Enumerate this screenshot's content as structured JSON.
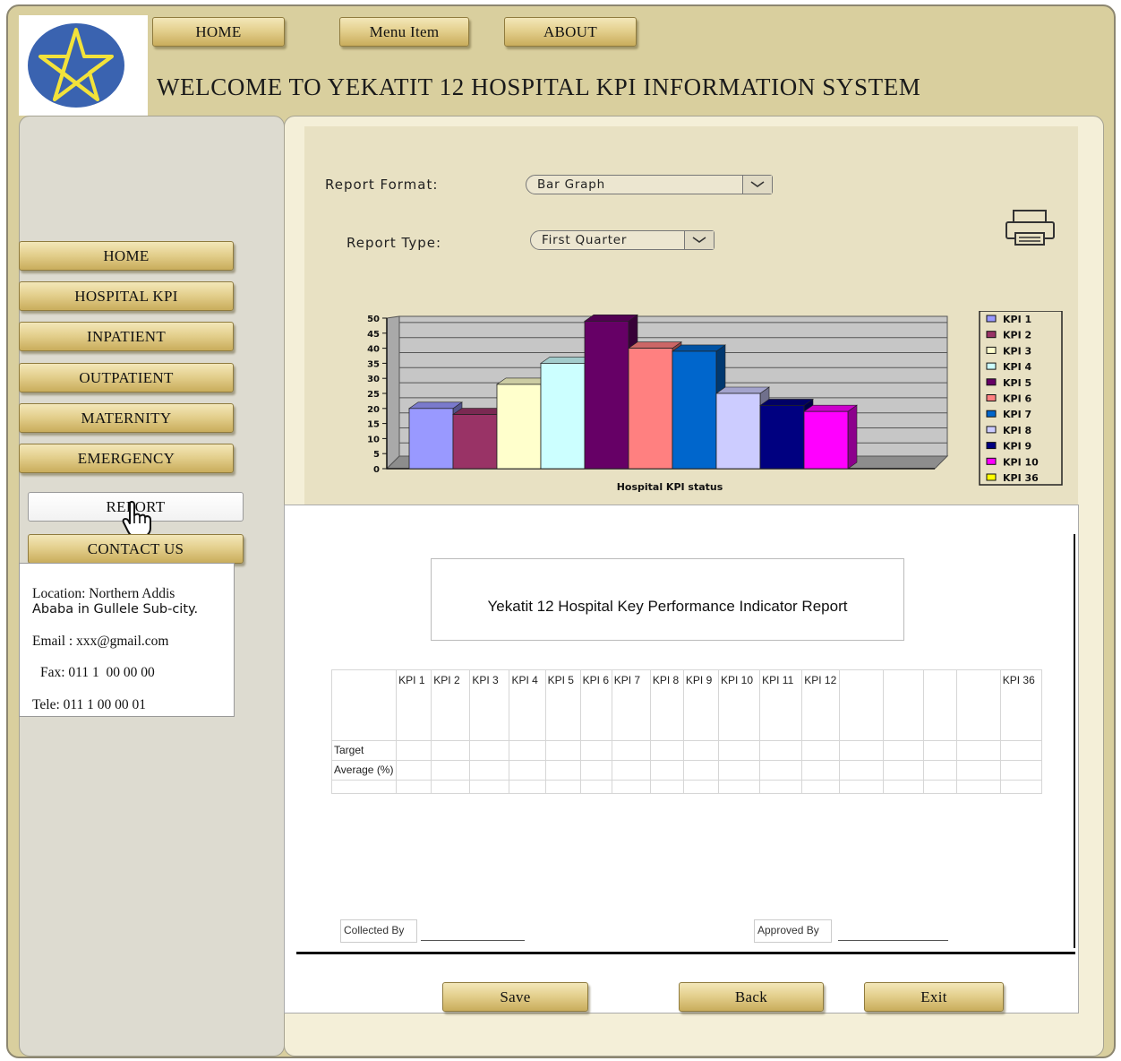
{
  "header": {
    "title": "WELCOME TO YEKATIT 12 HOSPITAL KPI INFORMATION SYSTEM",
    "nav": [
      "HOME",
      "Menu Item",
      "ABOUT"
    ],
    "logo_icon": "ethiopian-star-emblem-icon"
  },
  "sidebar": {
    "items": [
      "HOME",
      "HOSPITAL KPI",
      "INPATIENT",
      "OUTPATIENT",
      "MATERNITY",
      "EMERGENCY"
    ],
    "report_label": "REPORT",
    "contact_label": "CONTACT US"
  },
  "contact": {
    "location_line1": "Location: Northern Addis",
    "location_line2": "Ababa in Gullele Sub-city.",
    "email": "Email : xxx@gmail.com",
    "fax": "Fax: 011 1  00 00 00",
    "tele": "Tele: 011 1 00 00 01"
  },
  "controls": {
    "format_label": "Report Format:",
    "format_value": "Bar Graph",
    "type_label": "Report Type:",
    "type_value": "First Quarter"
  },
  "chart_data": {
    "type": "bar",
    "title": "",
    "xlabel": "Hospital KPI status",
    "ylabel": "",
    "ylim": [
      0,
      50
    ],
    "yticks": [
      0,
      5,
      10,
      15,
      20,
      25,
      30,
      35,
      40,
      45,
      50
    ],
    "grid": true,
    "legend_position": "right",
    "series": [
      {
        "name": "KPI 1",
        "value": 20,
        "color": "#9999ff"
      },
      {
        "name": "KPI 2",
        "value": 18,
        "color": "#993366"
      },
      {
        "name": "KPI 3",
        "value": 28,
        "color": "#ffffcc"
      },
      {
        "name": "KPI 4",
        "value": 35,
        "color": "#ccffff"
      },
      {
        "name": "KPI 5",
        "value": 49,
        "color": "#660066"
      },
      {
        "name": "KPI 6",
        "value": 40,
        "color": "#ff8080"
      },
      {
        "name": "KPI 7",
        "value": 39,
        "color": "#0066cc"
      },
      {
        "name": "KPI 8",
        "value": 25,
        "color": "#ccccff"
      },
      {
        "name": "KPI 9",
        "value": 21,
        "color": "#000080"
      },
      {
        "name": "KPI 10",
        "value": 19,
        "color": "#ff00ff"
      },
      {
        "name": "KPI 36",
        "value": null,
        "color": "#ffff00"
      }
    ]
  },
  "report": {
    "title": "Yekatit 12 Hospital Key Performance Indicator Report",
    "columns": [
      "",
      "KPI 1",
      "KPI 2",
      "KPI 3",
      "KPI 4",
      "KPI 5",
      "KPI 6",
      "KPI 7",
      "KPI 8",
      "KPI 9",
      "KPI 10",
      "KPI 11",
      "KPI 12",
      "",
      "",
      "",
      "",
      "KPI 36"
    ],
    "rows": [
      "Target",
      "Average (%)",
      ""
    ],
    "collected_by": "Collected By",
    "approved_by": "Approved By"
  },
  "actions": {
    "save": "Save",
    "back": "Back",
    "exit": "Exit"
  },
  "icons": {
    "print": "printer-icon",
    "pointer": "hand-pointer-icon"
  }
}
